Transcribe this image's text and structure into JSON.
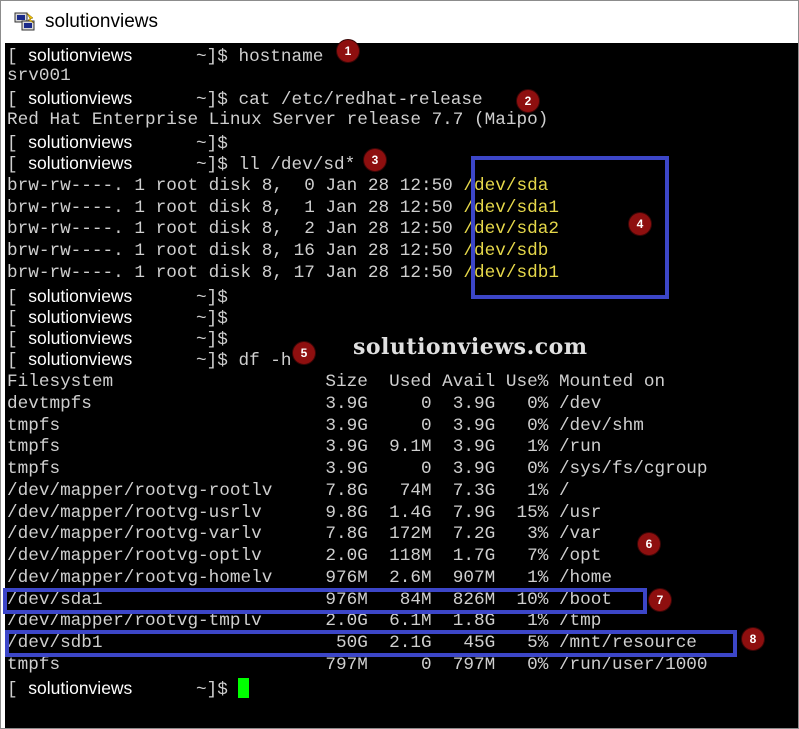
{
  "window": {
    "title": "solutionviews",
    "icon": "putty-icon"
  },
  "watermark": "solutionviews.com",
  "user": "solutionviews",
  "terminal": {
    "l1": {
      "a": "[ ",
      "b": "      ~]$ hostname"
    },
    "l2": "srv001",
    "l3": {
      "a": "[ ",
      "b": "      ~]$ cat /etc/redhat-release"
    },
    "l4": "Red Hat Enterprise Linux Server release 7.7 (Maipo)",
    "l5": {
      "a": "[ ",
      "b": "      ~]$"
    },
    "l6": {
      "a": "[ ",
      "b": "      ~]$ ll /dev/sd*"
    },
    "ls": [
      {
        "meta": "brw-rw----. 1 root disk 8,  0 Jan 28 12:50 ",
        "dev": "/dev/sda"
      },
      {
        "meta": "brw-rw----. 1 root disk 8,  1 Jan 28 12:50 ",
        "dev": "/dev/sda1"
      },
      {
        "meta": "brw-rw----. 1 root disk 8,  2 Jan 28 12:50 ",
        "dev": "/dev/sda2"
      },
      {
        "meta": "brw-rw----. 1 root disk 8, 16 Jan 28 12:50 ",
        "dev": "/dev/sdb"
      },
      {
        "meta": "brw-rw----. 1 root disk 8, 17 Jan 28 12:50 ",
        "dev": "/dev/sdb1"
      }
    ],
    "p1": {
      "a": "[ ",
      "b": "      ~]$"
    },
    "p2": {
      "a": "[ ",
      "b": "      ~]$"
    },
    "p3": {
      "a": "[ ",
      "b": "      ~]$"
    },
    "p4": {
      "a": "[ ",
      "b": "      ~]$ df -h"
    },
    "df": [
      "Filesystem                    Size  Used Avail Use% Mounted on",
      "devtmpfs                      3.9G     0  3.9G   0% /dev",
      "tmpfs                         3.9G     0  3.9G   0% /dev/shm",
      "tmpfs                         3.9G  9.1M  3.9G   1% /run",
      "tmpfs                         3.9G     0  3.9G   0% /sys/fs/cgroup",
      "/dev/mapper/rootvg-rootlv     7.8G   74M  7.3G   1% /",
      "/dev/mapper/rootvg-usrlv      9.8G  1.4G  7.9G  15% /usr",
      "/dev/mapper/rootvg-varlv      7.8G  172M  7.2G   3% /var",
      "/dev/mapper/rootvg-optlv      2.0G  118M  1.7G   7% /opt",
      "/dev/mapper/rootvg-homelv     976M  2.6M  907M   1% /home",
      "/dev/sda1                     976M   84M  826M  10% /boot",
      "/dev/mapper/rootvg-tmplv      2.0G  6.1M  1.8G   1% /tmp",
      "/dev/sdb1                      50G  2.1G   45G   5% /mnt/resource",
      "tmpfs                         797M     0  797M   0% /run/user/1000"
    ],
    "last": {
      "a": "[ ",
      "b": "      ~]$ "
    }
  },
  "markers": [
    "1",
    "2",
    "3",
    "4",
    "5",
    "6",
    "7",
    "8"
  ],
  "colors": {
    "highlight_box": "#3c46c8",
    "marker": "#8e0f0f",
    "cursor": "#00ff00",
    "device_text": "#e6d84a"
  }
}
